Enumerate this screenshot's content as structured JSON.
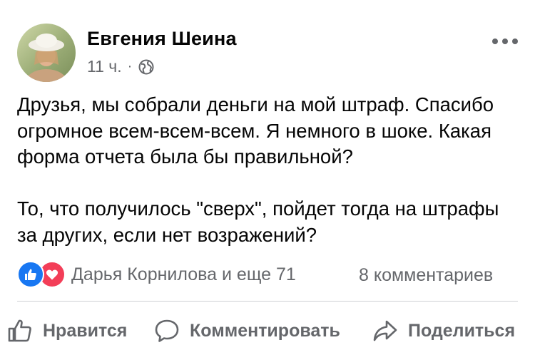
{
  "post": {
    "author": "Евгения Шеина",
    "time": "11 ч.",
    "separator": "·",
    "privacy_icon": "globe-icon",
    "paragraphs": [
      "Друзья, мы собрали деньги на мой штраф. Спасибо огромное всем-всем-всем. Я немного в шоке. Какая форма отчета была бы правильной?",
      "То, что получилось \"сверх\", пойдет тогда на штрафы за других, если нет возражений?"
    ],
    "reactions": {
      "types": [
        "like",
        "love"
      ],
      "summary": "Дарья Корнилова и еще 71"
    },
    "comments_count": "8 комментариев"
  },
  "actions": {
    "like": "Нравится",
    "comment": "Комментировать",
    "share": "Поделиться"
  },
  "colors": {
    "like_blue": "#1877f2",
    "love_red": "#f33e58",
    "secondary_text": "#65676b",
    "primary_text": "#050505"
  }
}
